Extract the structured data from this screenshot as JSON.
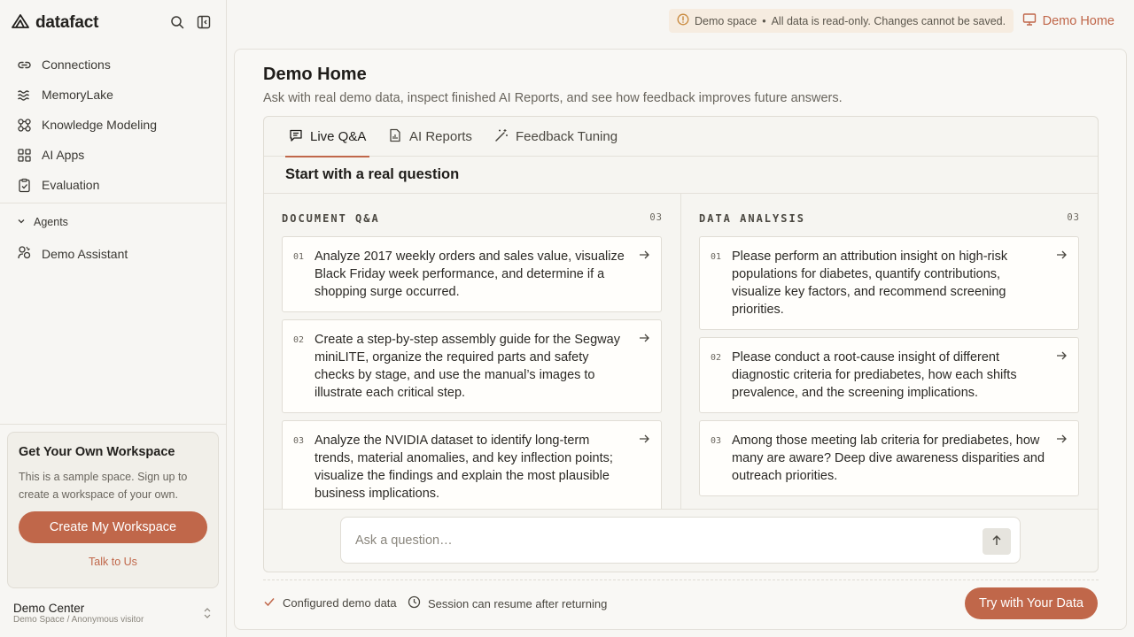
{
  "brand": {
    "name": "datafact"
  },
  "sidebar": {
    "nav": [
      {
        "label": "Connections",
        "icon": "link-icon"
      },
      {
        "label": "MemoryLake",
        "icon": "waves-icon"
      },
      {
        "label": "Knowledge Modeling",
        "icon": "network-icon"
      },
      {
        "label": "AI Apps",
        "icon": "grid-icon"
      },
      {
        "label": "Evaluation",
        "icon": "clipboard-check-icon"
      }
    ],
    "agents_label": "Agents",
    "agents": [
      {
        "label": "Demo Assistant",
        "icon": "agent-icon"
      }
    ],
    "promo": {
      "title": "Get Your Own Workspace",
      "text": "This is a sample space. Sign up to create a workspace of your own.",
      "button": "Create My Workspace",
      "link": "Talk to Us"
    },
    "account": {
      "name": "Demo Center",
      "sub": "Demo Space / Anonymous visitor"
    }
  },
  "topbar": {
    "banner_label": "Demo space",
    "banner_separator": "•",
    "banner_text": "All data is read-only. Changes cannot be saved.",
    "home_link": "Demo Home"
  },
  "main": {
    "title": "Demo Home",
    "subtitle": "Ask with real demo data, inspect finished AI Reports, and see how feedback improves future answers.",
    "tabs": [
      {
        "label": "Live Q&A",
        "icon": "chat-icon",
        "active": true
      },
      {
        "label": "AI Reports",
        "icon": "report-icon",
        "active": false
      },
      {
        "label": "Feedback Tuning",
        "icon": "magic-wand-icon",
        "active": false
      }
    ],
    "section_title": "Start with a real question",
    "columns": [
      {
        "title": "DOCUMENT Q&A",
        "count": "03",
        "questions": [
          {
            "num": "01",
            "text": "Analyze 2017 weekly orders and sales value, visualize Black Friday week performance, and determine if a shopping surge occurred."
          },
          {
            "num": "02",
            "text": "Create a step-by-step assembly guide for the Segway miniLITE, organize the required parts and safety checks by stage, and use the manual’s images to illustrate each critical step."
          },
          {
            "num": "03",
            "text": "Analyze the NVIDIA dataset to identify long-term trends, material anomalies, and key inflection points; visualize the findings and explain the most plausible business implications."
          }
        ]
      },
      {
        "title": "DATA ANALYSIS",
        "count": "03",
        "questions": [
          {
            "num": "01",
            "text": "Please perform an attribution insight on high-risk populations for diabetes, quantify contributions, visualize key factors, and recommend screening priorities."
          },
          {
            "num": "02",
            "text": "Please conduct a root-cause insight of different diagnostic criteria for prediabetes, how each shifts prevalence, and the screening implications."
          },
          {
            "num": "03",
            "text": "Among those meeting lab criteria for prediabetes, how many are aware? Deep dive awareness disparities and outreach priorities."
          }
        ]
      }
    ],
    "ask": {
      "placeholder": "Ask a question…"
    },
    "footer": {
      "item1": "Configured demo data",
      "item2": "Session can resume after returning",
      "button": "Try with Your Data"
    }
  },
  "colors": {
    "accent": "#c0674a",
    "banner_bg": "#f6ece0",
    "background": "#f7f6f3"
  }
}
